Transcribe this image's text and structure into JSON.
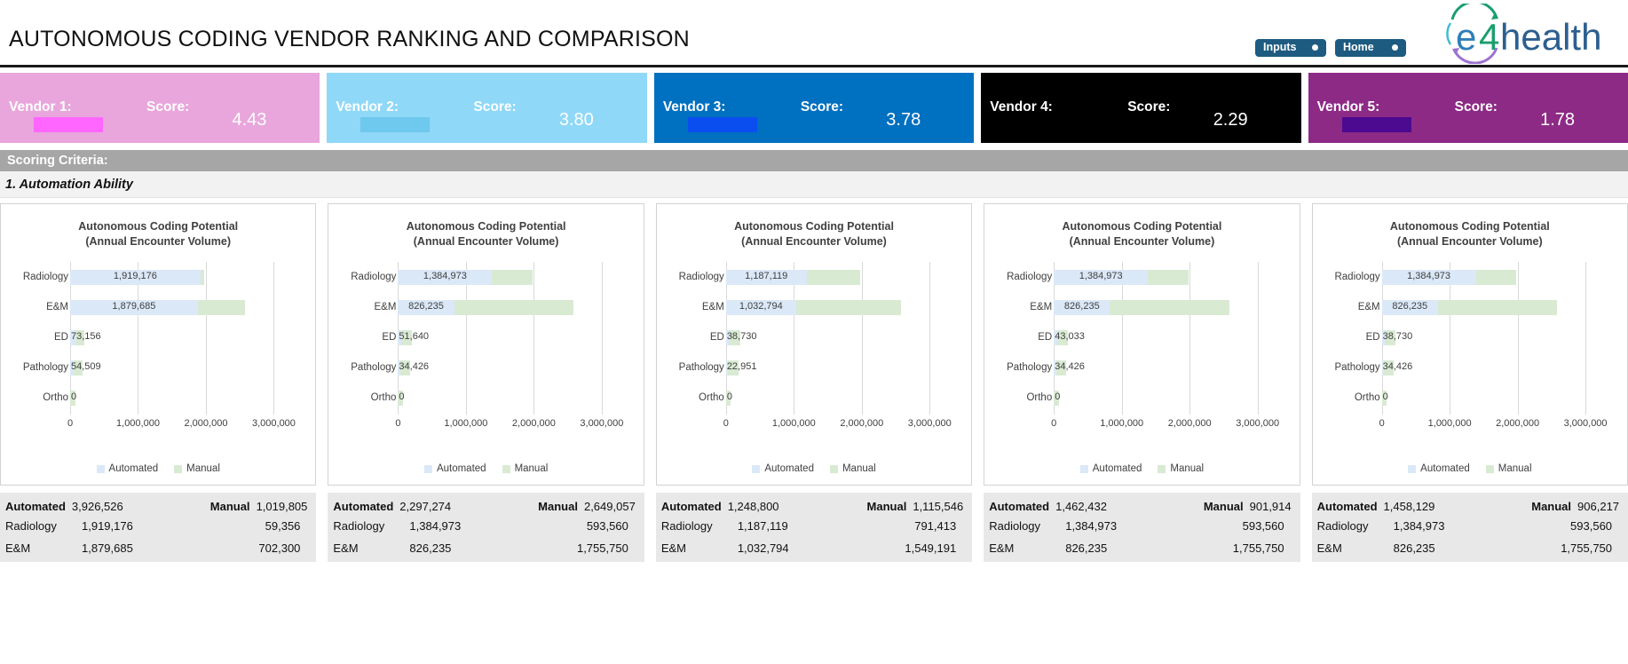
{
  "header": {
    "title": "AUTONOMOUS CODING VENDOR RANKING AND COMPARISON",
    "buttons": [
      {
        "label": "Inputs",
        "name": "inputs-button"
      },
      {
        "label": "Home",
        "name": "home-button"
      }
    ],
    "logo_text": "e4health"
  },
  "vendors": [
    {
      "label": "Vendor 1:",
      "score_label": "Score:",
      "score": "4.43",
      "bg": "#e8a6dc",
      "redaction": "#ff66ff"
    },
    {
      "label": "Vendor 2:",
      "score_label": "Score:",
      "score": "3.80",
      "bg": "#8fd8f7",
      "redaction": "#6fc8ee"
    },
    {
      "label": "Vendor 3:",
      "score_label": "Score:",
      "score": "3.78",
      "bg": "#0070c0",
      "redaction": "#0b4ef0"
    },
    {
      "label": "Vendor 4:",
      "score_label": "Score:",
      "score": "2.29",
      "bg": "#000000",
      "redaction": "#000000"
    },
    {
      "label": "Vendor 5:",
      "score_label": "Score:",
      "score": "1.78",
      "bg": "#8d2a86",
      "redaction": "#4b0a8f"
    }
  ],
  "criteria": {
    "section_label": "Scoring Criteria:",
    "subsection_label": "1. Automation Ability"
  },
  "chart_common": {
    "title_line1": "Autonomous Coding Potential",
    "title_line2": "(Annual Encounter Volume)",
    "legend": [
      {
        "label": "Automated",
        "color": "#dbe8f7"
      },
      {
        "label": "Manual",
        "color": "#d9ead3"
      }
    ],
    "xticks": [
      "0",
      "1,000,000",
      "2,000,000",
      "3,000,000"
    ],
    "xlim": [
      0,
      3300000
    ],
    "categories": [
      "Radiology",
      "E&M",
      "ED",
      "Pathology",
      "Ortho"
    ]
  },
  "chart_data": [
    {
      "type": "bar",
      "title": "Autonomous Coding Potential (Annual Encounter Volume)",
      "vendor": "Vendor 1",
      "categories": [
        "Radiology",
        "E&M",
        "ED",
        "Pathology",
        "Ortho"
      ],
      "series": [
        {
          "name": "Automated",
          "values": [
            1919176,
            1879685,
            73156,
            54509,
            0
          ]
        },
        {
          "name": "Manual",
          "values": [
            59356,
            702300,
            133079,
            125070,
            0
          ]
        }
      ],
      "labels": [
        "1,919,176",
        "1,879,685",
        "73,156",
        "54,509",
        "0"
      ],
      "xlabel": "",
      "ylabel": "",
      "xlim": [
        0,
        3300000
      ],
      "grid": true,
      "legend_position": "bottom"
    },
    {
      "type": "bar",
      "title": "Autonomous Coding Potential (Annual Encounter Volume)",
      "vendor": "Vendor 2",
      "categories": [
        "Radiology",
        "E&M",
        "ED",
        "Pathology",
        "Ortho"
      ],
      "series": [
        {
          "name": "Automated",
          "values": [
            1384973,
            826235,
            51640,
            34426,
            0
          ]
        },
        {
          "name": "Manual",
          "values": [
            593560,
            1755750,
            154595,
            145152,
            0
          ]
        }
      ],
      "labels": [
        "1,384,973",
        "826,235",
        "51,640",
        "34,426",
        "0"
      ],
      "xlabel": "",
      "ylabel": "",
      "xlim": [
        0,
        3300000
      ],
      "grid": true,
      "legend_position": "bottom"
    },
    {
      "type": "bar",
      "title": "Autonomous Coding Potential (Annual Encounter Volume)",
      "vendor": "Vendor 3",
      "categories": [
        "Radiology",
        "E&M",
        "ED",
        "Pathology",
        "Ortho"
      ],
      "series": [
        {
          "name": "Automated",
          "values": [
            1187119,
            1032794,
            38730,
            22951,
            0
          ]
        },
        {
          "name": "Manual",
          "values": [
            791413,
            1549191,
            167505,
            156627,
            0
          ]
        }
      ],
      "labels": [
        "1,187,119",
        "1,032,794",
        "38,730",
        "22,951",
        "0"
      ],
      "xlabel": "",
      "ylabel": "",
      "xlim": [
        0,
        3300000
      ],
      "grid": true,
      "legend_position": "bottom"
    },
    {
      "type": "bar",
      "title": "Autonomous Coding Potential (Annual Encounter Volume)",
      "vendor": "Vendor 4",
      "categories": [
        "Radiology",
        "E&M",
        "ED",
        "Pathology",
        "Ortho"
      ],
      "series": [
        {
          "name": "Automated",
          "values": [
            1384973,
            826235,
            43033,
            34426,
            0
          ]
        },
        {
          "name": "Manual",
          "values": [
            593560,
            1755750,
            163202,
            145152,
            0
          ]
        }
      ],
      "labels": [
        "1,384,973",
        "826,235",
        "43,033",
        "34,426",
        "0"
      ],
      "xlabel": "",
      "ylabel": "",
      "xlim": [
        0,
        3300000
      ],
      "grid": true,
      "legend_position": "bottom"
    },
    {
      "type": "bar",
      "title": "Autonomous Coding Potential (Annual Encounter Volume)",
      "vendor": "Vendor 5",
      "categories": [
        "Radiology",
        "E&M",
        "ED",
        "Pathology",
        "Ortho"
      ],
      "series": [
        {
          "name": "Automated",
          "values": [
            1384973,
            826235,
            38730,
            34426,
            0
          ]
        },
        {
          "name": "Manual",
          "values": [
            593560,
            1755750,
            167505,
            145152,
            0
          ]
        }
      ],
      "labels": [
        "1,384,973",
        "826,235",
        "38,730",
        "34,426",
        "0"
      ],
      "xlabel": "",
      "ylabel": "",
      "xlim": [
        0,
        3300000
      ],
      "grid": true,
      "legend_position": "bottom"
    }
  ],
  "summaries": [
    {
      "automated_label": "Automated",
      "automated_total": "3,926,526",
      "manual_label": "Manual",
      "manual_total": "1,019,805",
      "rows": [
        {
          "label": "Radiology",
          "automated": "1,919,176",
          "manual": "59,356"
        },
        {
          "label": "E&M",
          "automated": "1,879,685",
          "manual": "702,300"
        }
      ]
    },
    {
      "automated_label": "Automated",
      "automated_total": "2,297,274",
      "manual_label": "Manual",
      "manual_total": "2,649,057",
      "rows": [
        {
          "label": "Radiology",
          "automated": "1,384,973",
          "manual": "593,560"
        },
        {
          "label": "E&M",
          "automated": "826,235",
          "manual": "1,755,750"
        }
      ]
    },
    {
      "automated_label": "Automated",
      "automated_total": "1,248,800",
      "manual_label": "Manual",
      "manual_total": "1,115,546",
      "rows": [
        {
          "label": "Radiology",
          "automated": "1,187,119",
          "manual": "791,413"
        },
        {
          "label": "E&M",
          "automated": "1,032,794",
          "manual": "1,549,191"
        }
      ]
    },
    {
      "automated_label": "Automated",
      "automated_total": "1,462,432",
      "manual_label": "Manual",
      "manual_total": "901,914",
      "rows": [
        {
          "label": "Radiology",
          "automated": "1,384,973",
          "manual": "593,560"
        },
        {
          "label": "E&M",
          "automated": "826,235",
          "manual": "1,755,750"
        }
      ]
    },
    {
      "automated_label": "Automated",
      "automated_total": "1,458,129",
      "manual_label": "Manual",
      "manual_total": "906,217",
      "rows": [
        {
          "label": "Radiology",
          "automated": "1,384,973",
          "manual": "593,560"
        },
        {
          "label": "E&M",
          "automated": "826,235",
          "manual": "1,755,750"
        }
      ]
    }
  ]
}
